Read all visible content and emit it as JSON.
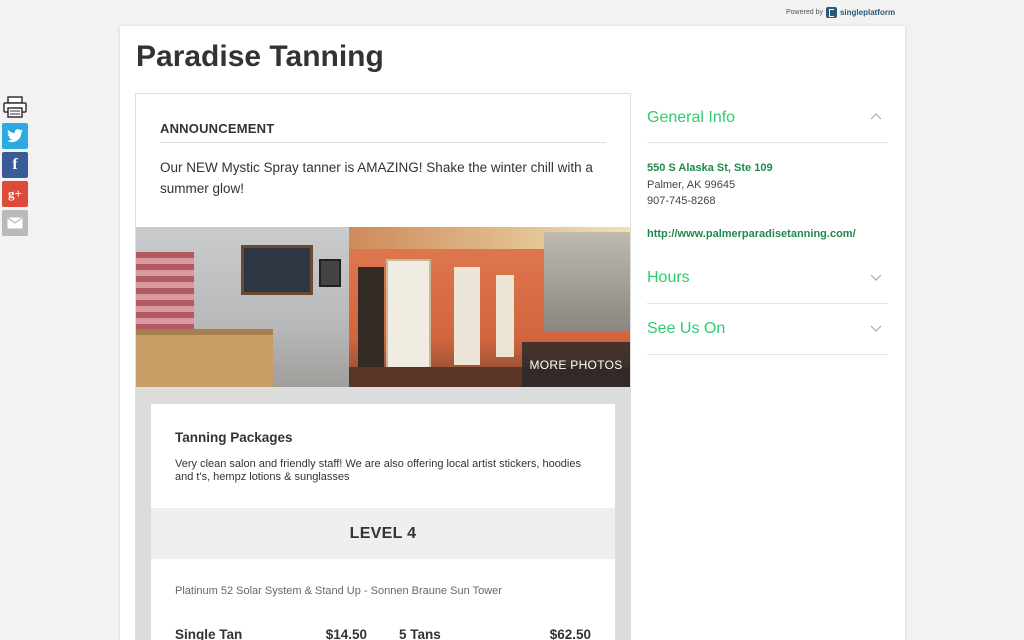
{
  "powered": {
    "prefix": "Powered by",
    "brand": "singleplatform"
  },
  "share": {
    "print_icon": "printer-icon",
    "twitter_icon": "twitter-icon",
    "facebook_glyph": "f",
    "google_glyph": "g+",
    "email_icon": "email-icon"
  },
  "business": {
    "name": "Paradise Tanning"
  },
  "announcement": {
    "heading": "ANNOUNCEMENT",
    "text": "Our NEW Mystic Spray tanner is AMAZING! Shake the winter chill with a summer glow!"
  },
  "photos": {
    "more_label": "MORE PHOTOS"
  },
  "package": {
    "title": "Tanning Packages",
    "description": "Very clean salon and friendly staff! We are also offering local artist stickers, hoodies and t's, hempz lotions & sunglasses",
    "level": "LEVEL 4",
    "level_description": "Platinum 52 Solar System & Stand Up - Sonnen Braune Sun Tower",
    "prices": [
      {
        "name": "Single Tan",
        "price": "$14.50"
      },
      {
        "name": "5 Tans",
        "price": "$62.50"
      }
    ]
  },
  "general_info": {
    "title": "General Info",
    "address": "550 S Alaska St, Ste 109",
    "city": "Palmer, AK 99645",
    "phone": "907-745-8268",
    "url": "http://www.palmerparadisetanning.com/"
  },
  "hours": {
    "title": "Hours"
  },
  "see_us_on": {
    "title": "See Us On"
  },
  "colors": {
    "accent": "#2ecc71",
    "link": "#1f8a4c",
    "twitter": "#2ba9e1",
    "facebook": "#3a5a98",
    "google": "#dc4b38"
  }
}
